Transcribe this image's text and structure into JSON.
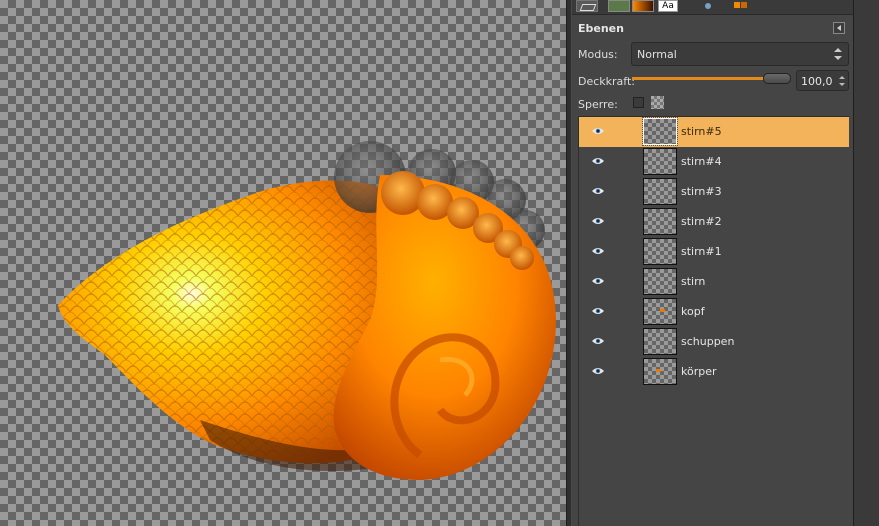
{
  "panel": {
    "title": "Ebenen",
    "mode_label": "Modus:",
    "mode_value": "Normal",
    "opacity_label": "Deckkraft:",
    "opacity_value": "100,0",
    "opacity_level": 1.0,
    "lock_label": "Sperre:"
  },
  "tabs": {
    "font_tab_label": "Aa"
  },
  "layers": [
    {
      "name": "stirn#5",
      "selected": true,
      "visible": true
    },
    {
      "name": "stirn#4",
      "selected": false,
      "visible": true
    },
    {
      "name": "stirn#3",
      "selected": false,
      "visible": true
    },
    {
      "name": "stirn#2",
      "selected": false,
      "visible": true
    },
    {
      "name": "stirn#1",
      "selected": false,
      "visible": true
    },
    {
      "name": "stirn",
      "selected": false,
      "visible": true
    },
    {
      "name": "kopf",
      "selected": false,
      "visible": true
    },
    {
      "name": "schuppen",
      "selected": false,
      "visible": true
    },
    {
      "name": "körper",
      "selected": false,
      "visible": true
    }
  ],
  "colors": {
    "accent": "#e58b1c",
    "selected_row": "#f3b35a",
    "fish_orange": "#ff7a00",
    "fish_yellow": "#ffd400"
  }
}
